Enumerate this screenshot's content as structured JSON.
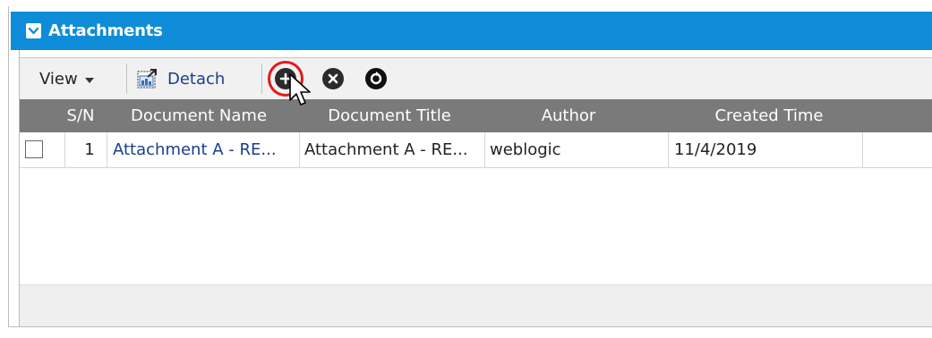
{
  "panel": {
    "title": "Attachments",
    "collapse_icon": "chevron-down-icon"
  },
  "toolbar": {
    "view_label": "View",
    "detach_label": "Detach",
    "add_icon": "plus-circle-icon",
    "remove_icon": "x-circle-icon",
    "refresh_icon": "refresh-circle-icon",
    "highlight_color": "#e11b1b"
  },
  "table": {
    "columns": [
      "S/N",
      "Document Name",
      "Document Title",
      "Author",
      "Created Time"
    ],
    "rows": [
      {
        "sn": "1",
        "document_name": "Attachment A - RE...",
        "document_title": "Attachment A - RE...",
        "author": "weblogic",
        "created_time": "11/4/2019"
      }
    ]
  },
  "colors": {
    "header_blue": "#0f8cd8",
    "grid_header": "#7a7a7a",
    "link": "#1a3e8a"
  }
}
